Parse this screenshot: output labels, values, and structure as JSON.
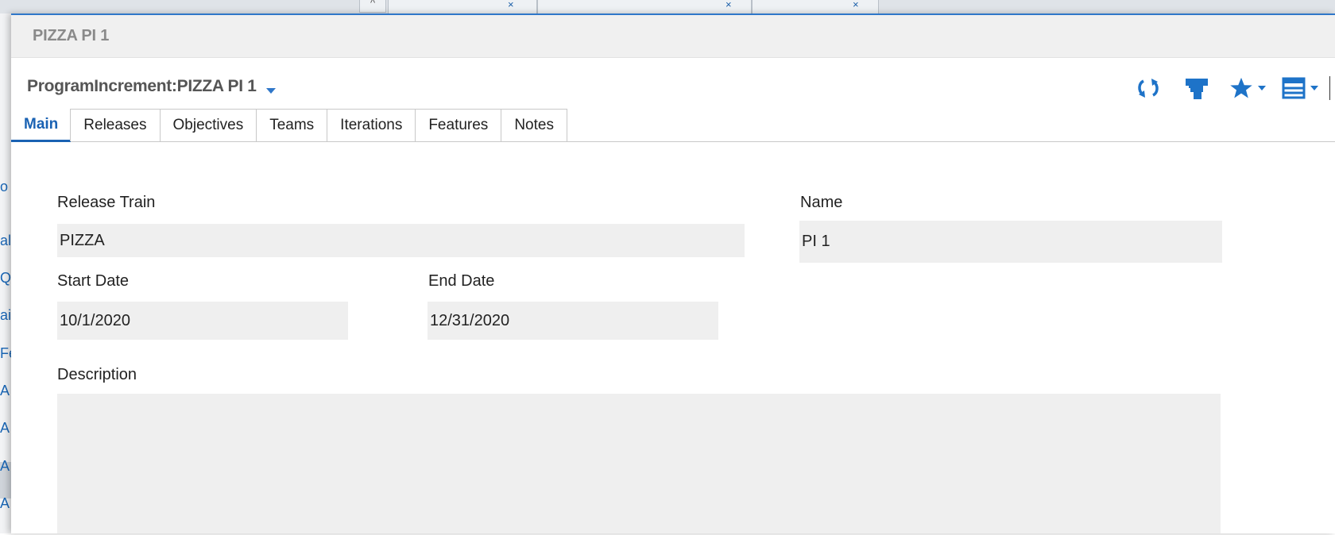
{
  "window": {
    "title": "PIZZA PI 1",
    "record_title": "ProgramIncrement:PIZZA PI 1"
  },
  "toolbar": {
    "icons": [
      "refresh-icon",
      "lock-icon",
      "star-icon",
      "layout-icon"
    ],
    "accent": "#1e73c8"
  },
  "tabs": [
    {
      "label": "Main",
      "active": true
    },
    {
      "label": "Releases",
      "active": false
    },
    {
      "label": "Objectives",
      "active": false
    },
    {
      "label": "Teams",
      "active": false
    },
    {
      "label": "Iterations",
      "active": false
    },
    {
      "label": "Features",
      "active": false
    },
    {
      "label": "Notes",
      "active": false
    }
  ],
  "form": {
    "release_train": {
      "label": "Release Train",
      "value": "PIZZA"
    },
    "name": {
      "label": "Name",
      "value": "PI 1"
    },
    "start_date": {
      "label": "Start Date",
      "value": "10/1/2020"
    },
    "end_date": {
      "label": "End Date",
      "value": "12/31/2020"
    },
    "description": {
      "label": "Description",
      "value": ""
    }
  },
  "background": {
    "sidebar_items": [
      "o",
      "al",
      "Q",
      "ai",
      "Fe",
      "A",
      "A",
      "A",
      "A"
    ]
  }
}
